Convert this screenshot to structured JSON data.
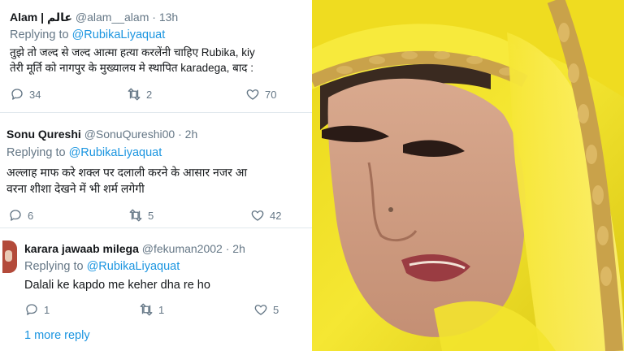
{
  "tweets": [
    {
      "name": "Alam | عالم",
      "handle": "@alam__alam",
      "time": "13h",
      "replying_label": "Replying to",
      "replying_to": "@RubikaLiyaquat",
      "lines": [
        "तुझे तो जल्द से जल्द आत्मा हत्या करलेंनी चाहिए Rubika, kiy",
        "तेरी मूर्ति को नागपुर के मुख्यालय मे स्थापित karadega, बाद :"
      ],
      "counts": {
        "replies": "34",
        "retweets": "2",
        "likes": "70"
      }
    },
    {
      "name": "Sonu Qureshi",
      "handle": "@SonuQureshi00",
      "time": "2h",
      "replying_label": "Replying to",
      "replying_to": "@RubikaLiyaquat",
      "lines": [
        "अल्लाह माफ करे शक्ल पर दलाली करने के आसार नजर आ",
        "वरना शीशा देखने में भी शर्म लगेगी"
      ],
      "counts": {
        "replies": "6",
        "retweets": "5",
        "likes": "42"
      }
    },
    {
      "name": "karara jawaab milega",
      "handle": "@fekuman2002",
      "time": "2h",
      "replying_label": "Replying to",
      "replying_to": "@RubikaLiyaquat",
      "lines": [
        "Dalali ke kapdo me keher dha re ho"
      ],
      "counts": {
        "replies": "1",
        "retweets": "1",
        "likes": "5"
      }
    }
  ],
  "more_reply": "1 more reply",
  "icons": [
    "reply-icon",
    "retweet-icon",
    "like-icon"
  ],
  "colors": {
    "link": "#1b95e0",
    "muted": "#657786",
    "text": "#14171a",
    "dupatta": "#f2e01a"
  }
}
